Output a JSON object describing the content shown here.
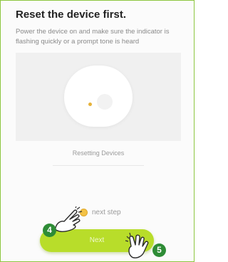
{
  "header": {
    "title": "Reset the device first.",
    "description": "Power the device on and make sure the indicator is flashing quickly or a prompt tone is heard"
  },
  "illustration": {
    "caption": "Resetting Devices"
  },
  "confirm": {
    "label": "next step",
    "checked": true
  },
  "next_button": {
    "label": "Next"
  },
  "callouts": [
    {
      "number": "4",
      "icon": "tap-hand-icon"
    },
    {
      "number": "5",
      "icon": "tap-hand-icon"
    }
  ],
  "colors": {
    "accent": "#b8dd2a",
    "frame_border": "#8dc63f",
    "callout_badge": "#2e8c36",
    "indicator": "#f3c246"
  }
}
